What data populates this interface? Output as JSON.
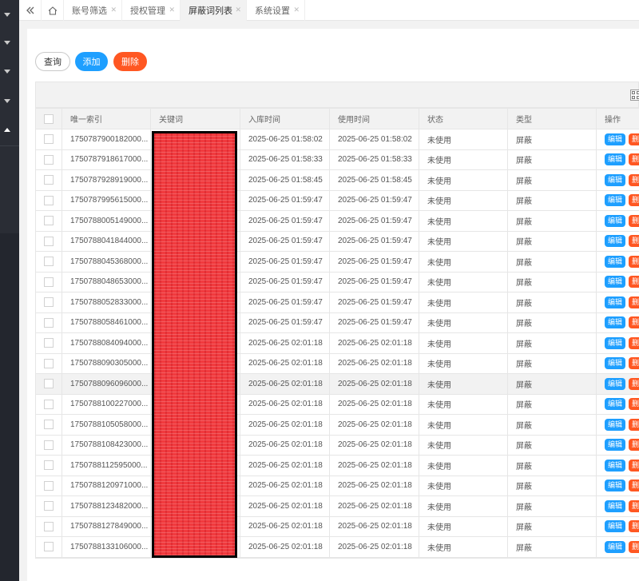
{
  "tabs": [
    {
      "label": "账号筛选",
      "active": false
    },
    {
      "label": "授权管理",
      "active": false
    },
    {
      "label": "屏蔽词列表",
      "active": true
    },
    {
      "label": "系统设置",
      "active": false
    }
  ],
  "toolbar": {
    "query_label": "查询",
    "add_label": "添加",
    "delete_label": "删除"
  },
  "table": {
    "columns": [
      "唯一索引",
      "关键词",
      "入库时间",
      "使用时间",
      "状态",
      "类型",
      "操作"
    ],
    "edit_label": "编辑",
    "delete_label": "删",
    "rows": [
      {
        "id": "1750787900182000...",
        "keyword": "",
        "created": "2025-06-25 01:58:02",
        "used": "2025-06-25 01:58:02",
        "status": "未使用",
        "type": "屏蔽"
      },
      {
        "id": "1750787918617000...",
        "keyword": "",
        "created": "2025-06-25 01:58:33",
        "used": "2025-06-25 01:58:33",
        "status": "未使用",
        "type": "屏蔽"
      },
      {
        "id": "1750787928919000...",
        "keyword": "",
        "created": "2025-06-25 01:58:45",
        "used": "2025-06-25 01:58:45",
        "status": "未使用",
        "type": "屏蔽"
      },
      {
        "id": "1750787995615000...",
        "keyword": "",
        "created": "2025-06-25 01:59:47",
        "used": "2025-06-25 01:59:47",
        "status": "未使用",
        "type": "屏蔽"
      },
      {
        "id": "1750788005149000...",
        "keyword": "",
        "created": "2025-06-25 01:59:47",
        "used": "2025-06-25 01:59:47",
        "status": "未使用",
        "type": "屏蔽"
      },
      {
        "id": "1750788041844000...",
        "keyword": "",
        "created": "2025-06-25 01:59:47",
        "used": "2025-06-25 01:59:47",
        "status": "未使用",
        "type": "屏蔽"
      },
      {
        "id": "1750788045368000...",
        "keyword": "",
        "created": "2025-06-25 01:59:47",
        "used": "2025-06-25 01:59:47",
        "status": "未使用",
        "type": "屏蔽"
      },
      {
        "id": "1750788048653000...",
        "keyword": "",
        "created": "2025-06-25 01:59:47",
        "used": "2025-06-25 01:59:47",
        "status": "未使用",
        "type": "屏蔽"
      },
      {
        "id": "1750788052833000...",
        "keyword": "",
        "created": "2025-06-25 01:59:47",
        "used": "2025-06-25 01:59:47",
        "status": "未使用",
        "type": "屏蔽"
      },
      {
        "id": "1750788058461000...",
        "keyword": "",
        "created": "2025-06-25 01:59:47",
        "used": "2025-06-25 01:59:47",
        "status": "未使用",
        "type": "屏蔽"
      },
      {
        "id": "1750788084094000...",
        "keyword": "",
        "created": "2025-06-25 02:01:18",
        "used": "2025-06-25 02:01:18",
        "status": "未使用",
        "type": "屏蔽"
      },
      {
        "id": "1750788090305000...",
        "keyword": "",
        "created": "2025-06-25 02:01:18",
        "used": "2025-06-25 02:01:18",
        "status": "未使用",
        "type": "屏蔽"
      },
      {
        "id": "1750788096096000...",
        "keyword": "",
        "created": "2025-06-25 02:01:18",
        "used": "2025-06-25 02:01:18",
        "status": "未使用",
        "type": "屏蔽",
        "highlight": true
      },
      {
        "id": "1750788100227000...",
        "keyword": "",
        "created": "2025-06-25 02:01:18",
        "used": "2025-06-25 02:01:18",
        "status": "未使用",
        "type": "屏蔽"
      },
      {
        "id": "1750788105058000...",
        "keyword": "",
        "created": "2025-06-25 02:01:18",
        "used": "2025-06-25 02:01:18",
        "status": "未使用",
        "type": "屏蔽"
      },
      {
        "id": "1750788108423000...",
        "keyword": "",
        "created": "2025-06-25 02:01:18",
        "used": "2025-06-25 02:01:18",
        "status": "未使用",
        "type": "屏蔽"
      },
      {
        "id": "1750788112595000...",
        "keyword": "",
        "created": "2025-06-25 02:01:18",
        "used": "2025-06-25 02:01:18",
        "status": "未使用",
        "type": "屏蔽"
      },
      {
        "id": "1750788120971000...",
        "keyword": "",
        "created": "2025-06-25 02:01:18",
        "used": "2025-06-25 02:01:18",
        "status": "未使用",
        "type": "屏蔽"
      },
      {
        "id": "1750788123482000...",
        "keyword": "",
        "created": "2025-06-25 02:01:18",
        "used": "2025-06-25 02:01:18",
        "status": "未使用",
        "type": "屏蔽"
      },
      {
        "id": "1750788127849000...",
        "keyword": "",
        "created": "2025-06-25 02:01:18",
        "used": "2025-06-25 02:01:18",
        "status": "未使用",
        "type": "屏蔽"
      },
      {
        "id": "1750788133106000...",
        "keyword": "",
        "created": "2025-06-25 02:01:18",
        "used": "2025-06-25 02:01:18",
        "status": "未使用",
        "type": "屏蔽"
      }
    ]
  },
  "colors": {
    "primary": "#1e9fff",
    "danger": "#ff5722",
    "sidebar": "#23262e",
    "redaction": "#f03a3e"
  }
}
